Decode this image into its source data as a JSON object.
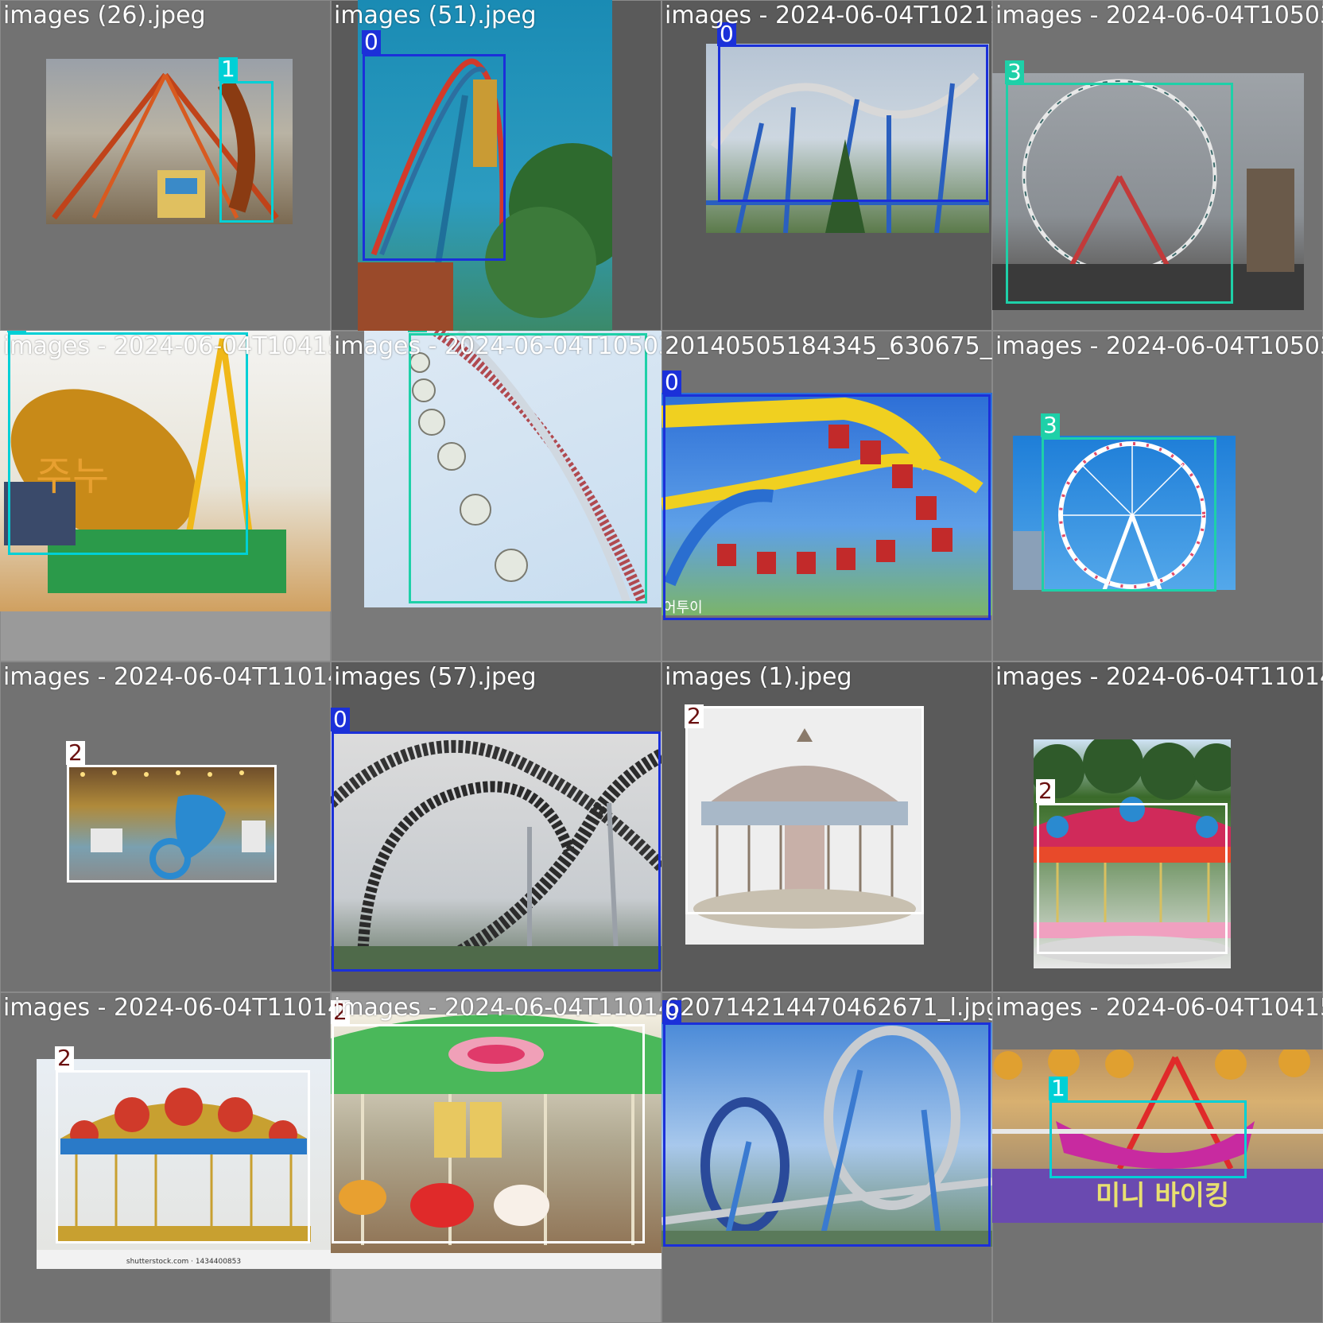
{
  "mosaic": {
    "class_colors": {
      "0": "#1b30d9",
      "1": "#00d0d6",
      "2": "#ffffff",
      "3": "#1ed0a8"
    },
    "tiles": [
      {
        "filename": "images (26).jpeg",
        "label": "1",
        "scene": "pirate ship swing ride"
      },
      {
        "filename": "images (51).jpeg",
        "label": "0",
        "scene": "vertical coaster"
      },
      {
        "filename": "images - 2024-06-04T102116.630.jpeg",
        "label": "0",
        "scene": "blue coaster"
      },
      {
        "filename": "images - 2024-06-04T105039",
        "label": "3",
        "scene": "ferris wheel"
      },
      {
        "filename": "images - 2024-06-04T104154.jpeg",
        "label": "1",
        "scene": "gold ship ride",
        "signage": "주누"
      },
      {
        "filename": "images - 2024-06-04T105032.jpeg",
        "label": "3",
        "scene": "ferris wheel closeup"
      },
      {
        "filename": "20140505184345_630675_600_394.jpg",
        "label": "0",
        "scene": "suspended coaster",
        "signage": "어투이"
      },
      {
        "filename": "images - 2024-06-04T105039",
        "label": "3",
        "scene": "white ferris wheel"
      },
      {
        "filename": "images - 2024-06-04T110149.902.jpeg",
        "label": "2",
        "scene": "carousel"
      },
      {
        "filename": "images (57).jpeg",
        "label": "0",
        "scene": "black coaster loops"
      },
      {
        "filename": "images (1).jpeg",
        "label": "2",
        "scene": "ornate carousel"
      },
      {
        "filename": "images - 2024-06-04T11014",
        "label": "2",
        "scene": "carousel under trees"
      },
      {
        "filename": "images - 2024-06-04T110147.653.jpeg",
        "label": "2",
        "scene": "carousel",
        "watermark": "shutterstock.com · 1434400853"
      },
      {
        "filename": "images - 2024-06-04T110143.362.jpeg",
        "label": "2",
        "scene": "carousel horses"
      },
      {
        "filename": "620714214470462671_l.jpg",
        "label": "0",
        "scene": "loop coaster"
      },
      {
        "filename": "images - 2024-06-04T104154",
        "label": "1",
        "scene": "pink ship ride",
        "signage": "미니 바이킹"
      }
    ]
  }
}
